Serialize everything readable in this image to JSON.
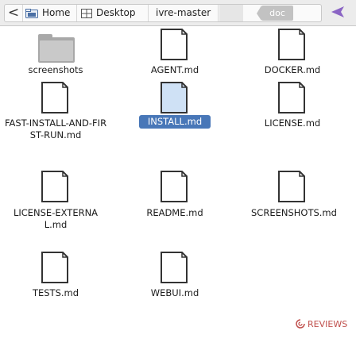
{
  "pathbar": {
    "back_glyph": "<",
    "home": "Home",
    "desktop": "Desktop",
    "repo": "ivre-master",
    "current": "doc",
    "forward_icon": "diamond-arrow-icon"
  },
  "files": [
    {
      "name": "screenshots",
      "kind": "folder"
    },
    {
      "name": "AGENT.md",
      "kind": "document"
    },
    {
      "name": "DOCKER.md",
      "kind": "document"
    },
    {
      "name": "FAST-INSTALL-AND-FIRST-RUN.md",
      "kind": "document"
    },
    {
      "name": "INSTALL.md",
      "kind": "document",
      "selected": true
    },
    {
      "name": "LICENSE.md",
      "kind": "document"
    },
    {
      "name": "LICENSE-EXTERNAL.md",
      "kind": "document"
    },
    {
      "name": "README.md",
      "kind": "document"
    },
    {
      "name": "SCREENSHOTS.md",
      "kind": "document"
    },
    {
      "name": "TESTS.md",
      "kind": "document"
    },
    {
      "name": "WEBUI.md",
      "kind": "document"
    }
  ],
  "watermark": "REVIEWS"
}
